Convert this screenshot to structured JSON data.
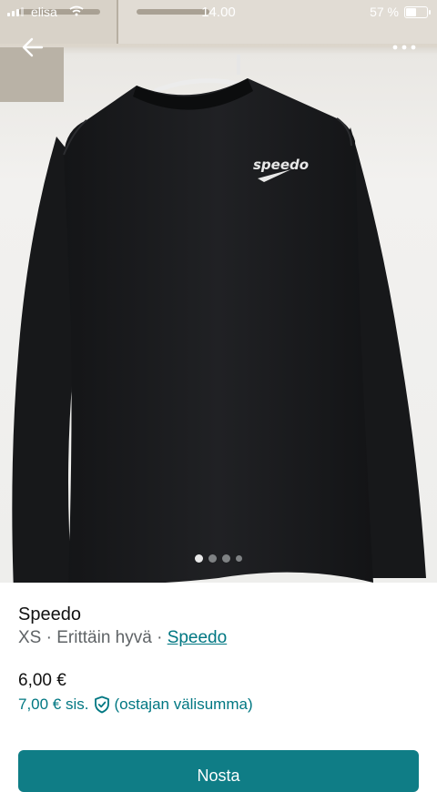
{
  "status_bar": {
    "carrier": "elisa",
    "time": "14.00",
    "battery": "57 %",
    "battery_level": 0.57
  },
  "nav": {
    "back_icon": "arrow-left-icon",
    "more_icon": "more-horizontal-icon"
  },
  "photo": {
    "logo_text": "speedo",
    "page_count": 4,
    "active_page": 1
  },
  "item": {
    "title": "Speedo",
    "size": "XS",
    "separator": "·",
    "condition": "Erittäin hyvä",
    "brand": "Speedo",
    "price": "6,00 €",
    "price_incl": "7,00 € sis.",
    "buyer_protection": "(ostajan välisumma)"
  },
  "actions": {
    "buy_label": "Nosta"
  },
  "colors": {
    "accent": "#007782",
    "button": "#0f7d86",
    "muted_text": "#5f6366",
    "shirt": "#1c1d1f"
  }
}
